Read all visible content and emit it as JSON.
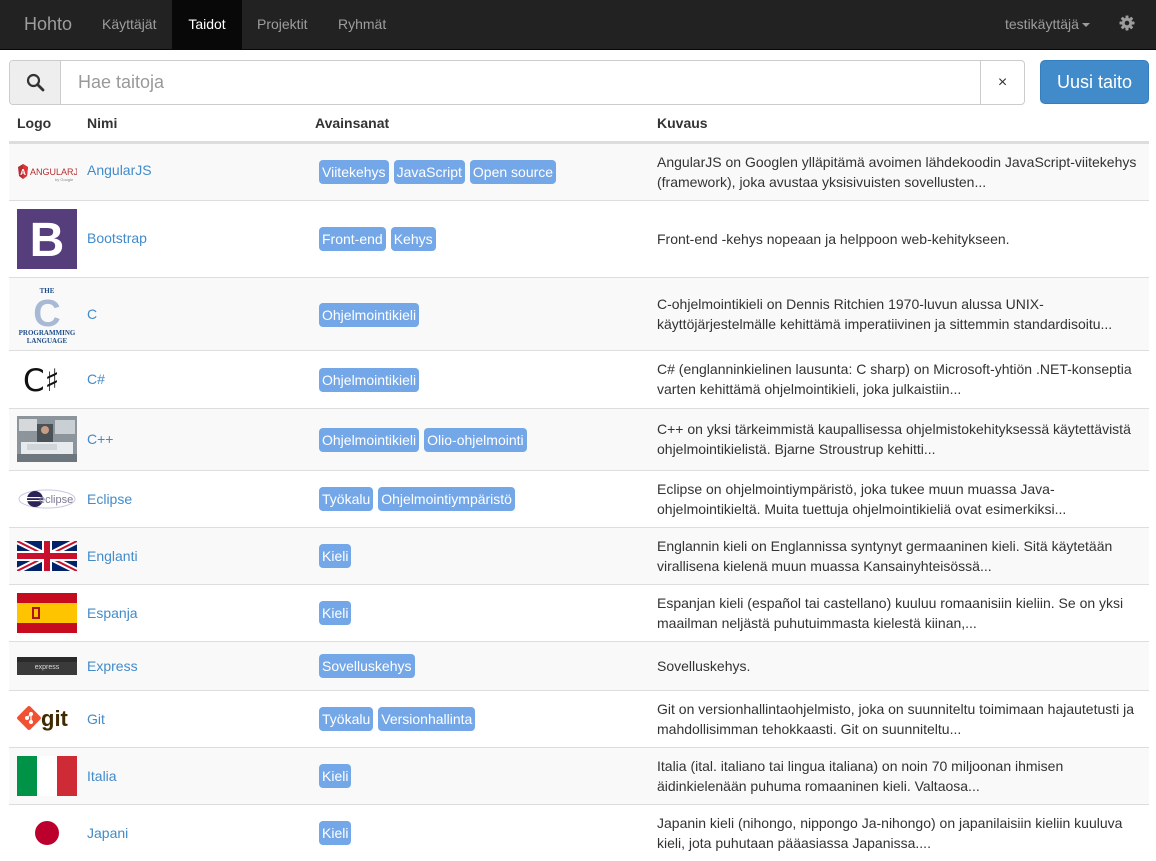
{
  "navbar": {
    "brand": "Hohto",
    "items": [
      {
        "label": "Käyttäjät",
        "active": false
      },
      {
        "label": "Taidot",
        "active": true
      },
      {
        "label": "Projektit",
        "active": false
      },
      {
        "label": "Ryhmät",
        "active": false
      }
    ],
    "user": "testikäyttäjä",
    "settings_icon": "gear-icon"
  },
  "search": {
    "icon": "search-icon",
    "placeholder": "Hae taitoja",
    "value": "",
    "clear_label": "×"
  },
  "new_button": "Uusi taito",
  "table": {
    "headers": [
      "Logo",
      "Nimi",
      "Avainsanat",
      "Kuvaus"
    ],
    "rows": [
      {
        "logo": "angularjs-logo",
        "name": "AngularJS",
        "tags": [
          "Viitekehys",
          "JavaScript",
          "Open source"
        ],
        "desc": [
          "AngularJS on Googlen ylläpitämä avoimen lähdekoodin JavaScript-viitekehys",
          "(framework), joka avustaa yksisivuisten sovellusten..."
        ]
      },
      {
        "logo": "bootstrap-logo",
        "name": "Bootstrap",
        "tags": [
          "Front-end",
          "Kehys"
        ],
        "desc": [
          "Front-end -kehys nopeaan ja helppoon web-kehitykseen."
        ]
      },
      {
        "logo": "c-language-logo",
        "name": "C",
        "tags": [
          "Ohjelmointikieli"
        ],
        "desc": [
          "C-ohjelmointikieli on Dennis Ritchien 1970-luvun alussa UNIX-",
          "käyttöjärjestelmälle kehittämä imperatiivinen ja sittemmin standardisoitu..."
        ]
      },
      {
        "logo": "csharp-logo",
        "name": "C#",
        "tags": [
          "Ohjelmointikieli"
        ],
        "desc": [
          "C# (englanninkielinen lausunta: C sharp) on Microsoft-yhtiön .NET-konseptia",
          "varten kehittämä ohjelmointikieli, joka julkaistiin..."
        ]
      },
      {
        "logo": "cpp-logo",
        "name": "C++",
        "tags": [
          "Ohjelmointikieli",
          "Olio-ohjelmointi"
        ],
        "desc": [
          "C++ on yksi tärkeimmistä kaupallisessa ohjelmistokehityksessä käytettävistä",
          "ohjelmointikielistä. Bjarne Stroustrup kehitti..."
        ]
      },
      {
        "logo": "eclipse-logo",
        "name": "Eclipse",
        "tags": [
          "Työkalu",
          "Ohjelmointiympäristö"
        ],
        "desc": [
          "Eclipse on ohjelmointiympäristö, joka tukee muun muassa Java-",
          "ohjelmointikieltä. Muita tuettuja ohjelmointikieliä ovat esimerkiksi..."
        ]
      },
      {
        "logo": "uk-flag-logo",
        "name": "Englanti",
        "tags": [
          "Kieli"
        ],
        "desc": [
          "Englannin kieli on Englannissa syntynyt germaaninen kieli. Sitä käytetään",
          "virallisena kielenä muun muassa Kansainyhteisössä..."
        ]
      },
      {
        "logo": "spain-flag-logo",
        "name": "Espanja",
        "tags": [
          "Kieli"
        ],
        "desc": [
          "Espanjan kieli (español tai castellano) kuuluu romaanisiin kieliin. Se on yksi",
          "maailman neljästä puhutuimmasta kielestä kiinan,..."
        ]
      },
      {
        "logo": "express-logo",
        "name": "Express",
        "tags": [
          "Sovelluskehys"
        ],
        "desc": [
          "Sovelluskehys."
        ]
      },
      {
        "logo": "git-logo",
        "name": "Git",
        "tags": [
          "Työkalu",
          "Versionhallinta"
        ],
        "desc": [
          "Git on versionhallintaohjelmisto, joka on suunniteltu toimimaan hajautetusti ja",
          "mahdollisimman tehokkaasti. Git on suunniteltu..."
        ]
      },
      {
        "logo": "italy-flag-logo",
        "name": "Italia",
        "tags": [
          "Kieli"
        ],
        "desc": [
          "Italia (ital. italiano tai lingua italiana) on noin 70 miljoonan ihmisen",
          "äidinkielenään puhuma romaaninen kieli. Valtaosa..."
        ]
      },
      {
        "logo": "japan-flag-logo",
        "name": "Japani",
        "tags": [
          "Kieli"
        ],
        "desc": [
          "Japanin kieli (nihongo, nippongo Ja-nihongo) on japanilaisiin kieliin kuuluva",
          "kieli, jota puhutaan pääasiassa Japanissa...."
        ]
      }
    ]
  },
  "logo_text": {
    "angular": "ANGULARJS",
    "angular_sub": "by Google",
    "c_top": "THE",
    "c_letter": "C",
    "c_bottom1": "PROGRAMMING",
    "c_bottom2": "LANGUAGE",
    "csharp": "C♯",
    "eclipse": "eclipse",
    "express": "express",
    "git": "git"
  },
  "colors": {
    "navbar_bg": "#222222",
    "link": "#428bca",
    "tag_bg": "#73a7e8",
    "primary_button": "#428bca"
  }
}
